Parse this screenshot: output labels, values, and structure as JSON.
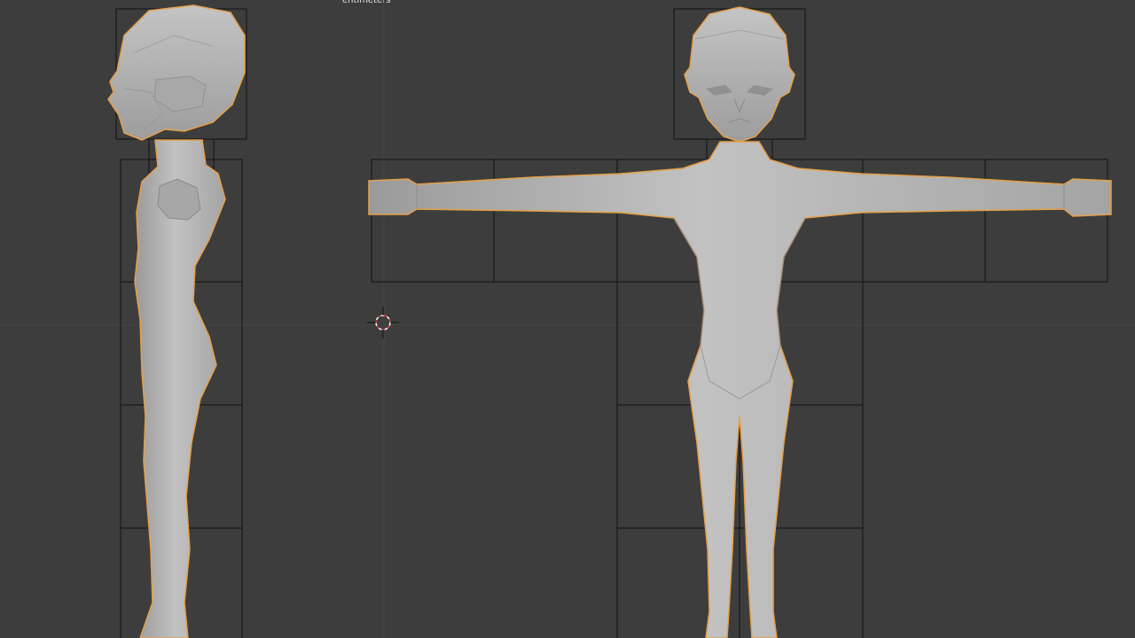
{
  "viewport": {
    "units_label": "entimeters",
    "background_color": "#3d3d3d",
    "mesh_color": "#b4b4b4",
    "selection_outline_color": "#e6a04a",
    "cell_border_color": "#111111"
  },
  "objects": [
    {
      "name": "character-side-view",
      "description_icon": "mesh-object"
    },
    {
      "name": "character-front-view",
      "description_icon": "mesh-object"
    }
  ],
  "cursor": {
    "icon": "3d-cursor-icon"
  }
}
